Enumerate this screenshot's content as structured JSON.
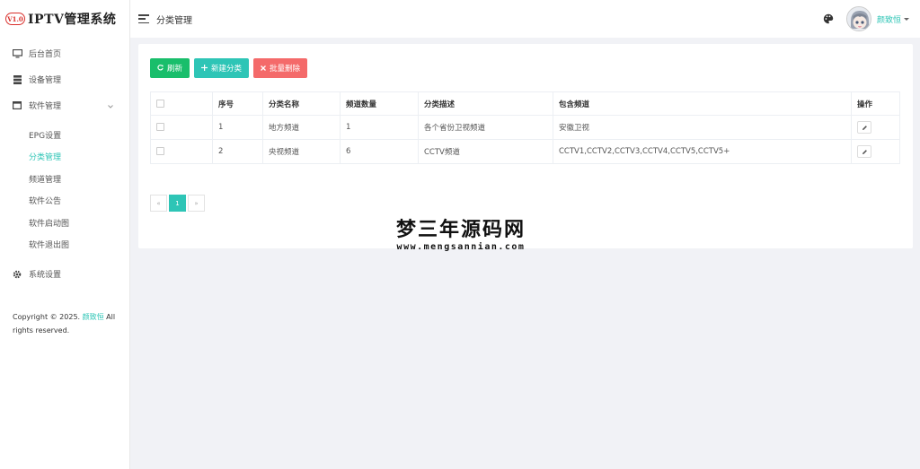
{
  "brand": {
    "badge": "V1.0",
    "title": "IPTV管理系统"
  },
  "sidebar": {
    "items": [
      {
        "label": "后台首页",
        "icon": "monitor-icon"
      },
      {
        "label": "设备管理",
        "icon": "server-icon"
      },
      {
        "label": "软件管理",
        "icon": "window-icon",
        "expanded": true
      }
    ],
    "subitems": [
      {
        "label": "EPG设置"
      },
      {
        "label": "分类管理",
        "active": true
      },
      {
        "label": "频道管理"
      },
      {
        "label": "软件公告"
      },
      {
        "label": "软件启动图"
      },
      {
        "label": "软件退出图"
      }
    ],
    "settings": {
      "label": "系统设置",
      "icon": "gear-icon"
    }
  },
  "copyright": {
    "prefix": "Copyright © 2025.",
    "author": "颜致恒",
    "suffix": "All rights reserved."
  },
  "header": {
    "title": "分类管理",
    "username": "颜致恒"
  },
  "toolbar": {
    "refresh": "刷新",
    "add": "新建分类",
    "batch_delete": "批量删除"
  },
  "table": {
    "headers": [
      "序号",
      "分类名称",
      "频道数量",
      "分类描述",
      "包含频道",
      "操作"
    ],
    "rows": [
      {
        "id": "1",
        "name": "地方频道",
        "count": "1",
        "desc": "各个省份卫视频道",
        "channels": "安徽卫视"
      },
      {
        "id": "2",
        "name": "央视频道",
        "count": "6",
        "desc": "CCTV频道",
        "channels": "CCTV1,CCTV2,CCTV3,CCTV4,CCTV5,CCTV5+"
      }
    ]
  },
  "pagination": {
    "prev": "«",
    "current": "1",
    "next": "»"
  },
  "watermark": {
    "title": "梦三年源码网",
    "url": "www.mengsannian.com"
  },
  "colors": {
    "accent": "#2ec5b6",
    "refresh": "#19be6b",
    "danger": "#f46a6a",
    "background": "#f1f2f6"
  }
}
